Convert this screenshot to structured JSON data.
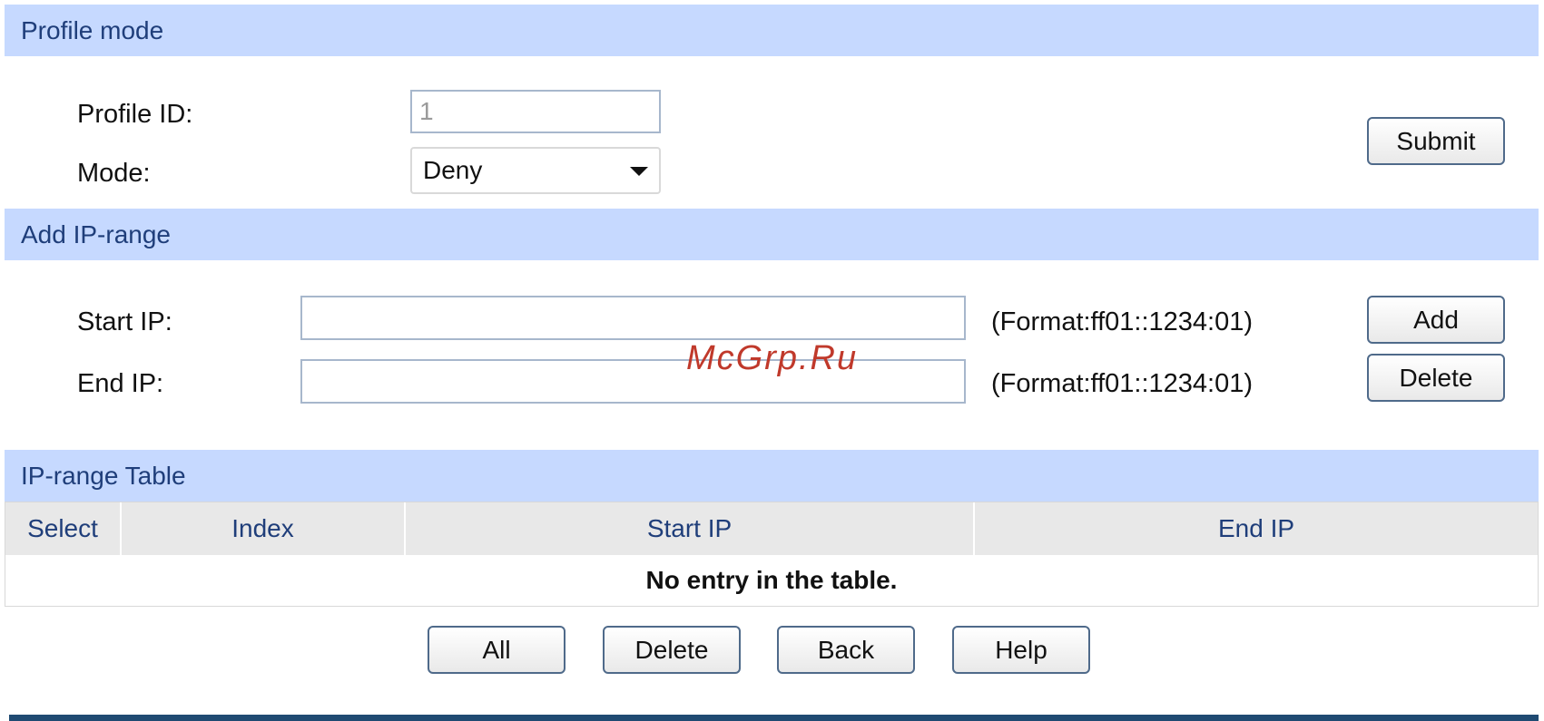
{
  "profile_mode": {
    "header": "Profile mode",
    "profile_id_label": "Profile ID:",
    "profile_id_value": "1",
    "mode_label": "Mode:",
    "mode_value": "Deny",
    "submit_label": "Submit"
  },
  "add_ip_range": {
    "header": "Add IP-range",
    "start_ip_label": "Start IP:",
    "start_ip_value": "",
    "start_ip_hint": "(Format:ff01::1234:01)",
    "end_ip_label": "End IP:",
    "end_ip_value": "",
    "end_ip_hint": "(Format:ff01::1234:01)",
    "add_label": "Add",
    "delete_label": "Delete"
  },
  "ip_range_table": {
    "header": "IP-range Table",
    "columns": [
      "Select",
      "Index",
      "Start IP",
      "End IP"
    ],
    "empty_message": "No entry in the table."
  },
  "actions": {
    "all_label": "All",
    "delete_label": "Delete",
    "back_label": "Back",
    "help_label": "Help"
  },
  "watermark": "McGrp.Ru",
  "colors": {
    "section_header_bg": "#c6d9ff",
    "section_header_text": "#1f3e7a",
    "table_header_bg": "#e8e8e8",
    "footer_bar": "#1f4a72",
    "watermark": "#c0392b"
  }
}
